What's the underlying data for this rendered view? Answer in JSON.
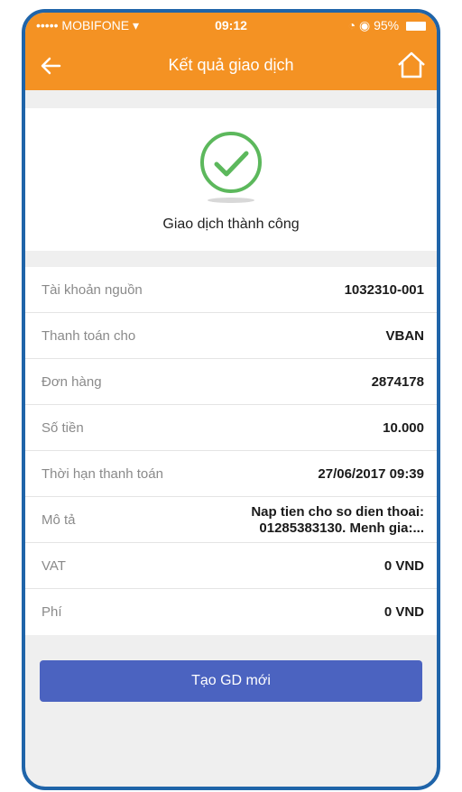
{
  "status_bar": {
    "carrier": "MOBIFONE",
    "time": "09:12",
    "battery": "95%"
  },
  "header": {
    "title": "Kết quả giao dịch",
    "back_icon": "arrow-left-icon",
    "home_icon": "home-icon"
  },
  "result": {
    "icon": "check-circle-icon",
    "message": "Giao dịch thành công",
    "color": "#5cb85c"
  },
  "details": [
    {
      "label": "Tài khoản nguồn",
      "value": "1032310-001"
    },
    {
      "label": "Thanh toán cho",
      "value": "VBAN"
    },
    {
      "label": "Đơn hàng",
      "value": "2874178"
    },
    {
      "label": "Số tiền",
      "value": "10.000"
    },
    {
      "label": "Thời hạn thanh toán",
      "value": "27/06/2017 09:39"
    },
    {
      "label": "Mô tả",
      "value_line1": "Nap tien cho so dien thoai:",
      "value_line2": "01285383130. Menh gia:..."
    },
    {
      "label": "VAT",
      "value": "0 VND"
    },
    {
      "label": "Phí",
      "value": "0 VND"
    }
  ],
  "actions": {
    "new_transaction_label": "Tạo GD mới"
  },
  "colors": {
    "header": "#f49223",
    "button": "#4b63c0",
    "frame": "#1f64a9"
  }
}
